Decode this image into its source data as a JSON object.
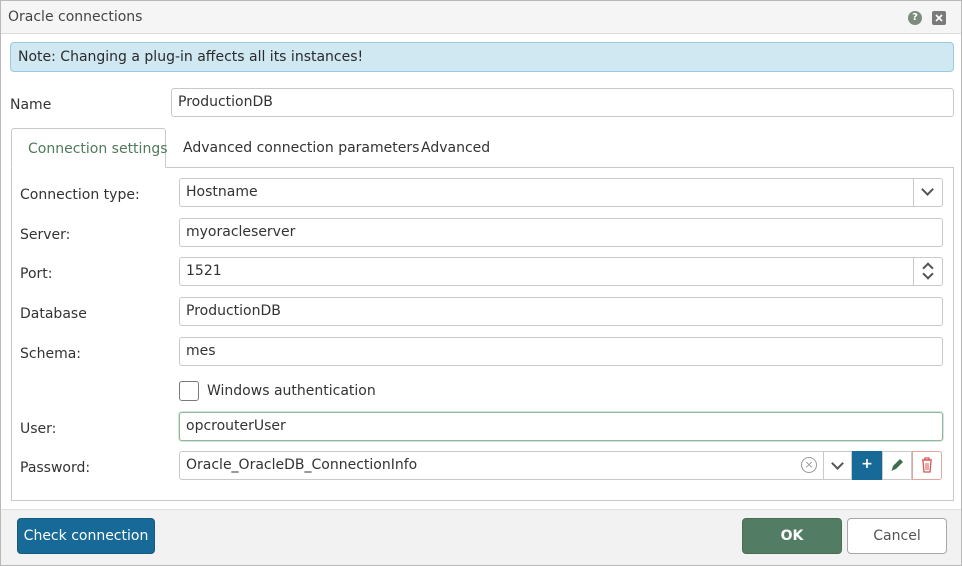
{
  "window": {
    "title": "Oracle connections"
  },
  "note": "Note: Changing a plug-in affects all its instances!",
  "name": {
    "label": "Name",
    "value": "ProductionDB"
  },
  "tabs": [
    {
      "label": "Connection settings"
    },
    {
      "label": "Advanced connection parameters"
    },
    {
      "label": "Advanced"
    }
  ],
  "form": {
    "connection_type": {
      "label": "Connection type:",
      "value": "Hostname"
    },
    "server": {
      "label": "Server:",
      "value": "myoracleserver"
    },
    "port": {
      "label": "Port:",
      "value": "1521"
    },
    "database": {
      "label": "Database",
      "value": "ProductionDB"
    },
    "schema": {
      "label": "Schema:",
      "value": "mes"
    },
    "windows_auth": {
      "label": "Windows authentication",
      "checked": false
    },
    "user": {
      "label": "User:",
      "value": "opcrouterUser"
    },
    "password": {
      "label": "Password:",
      "value": "Oracle_OracleDB_ConnectionInfo"
    }
  },
  "buttons": {
    "check_connection": "Check connection",
    "ok": "OK",
    "cancel": "Cancel",
    "add": "+"
  },
  "icons": {
    "help": "help-icon",
    "close": "close-icon",
    "dropdown": "chevron-down-icon",
    "spinner": "spinner-icon",
    "clear": "clear-icon",
    "edit": "pencil-icon",
    "delete": "trash-icon"
  },
  "colors": {
    "accent_blue": "#176a98",
    "accent_green": "#527c63",
    "note_bg": "#cfe8f2",
    "delete_red": "#d9534f"
  }
}
